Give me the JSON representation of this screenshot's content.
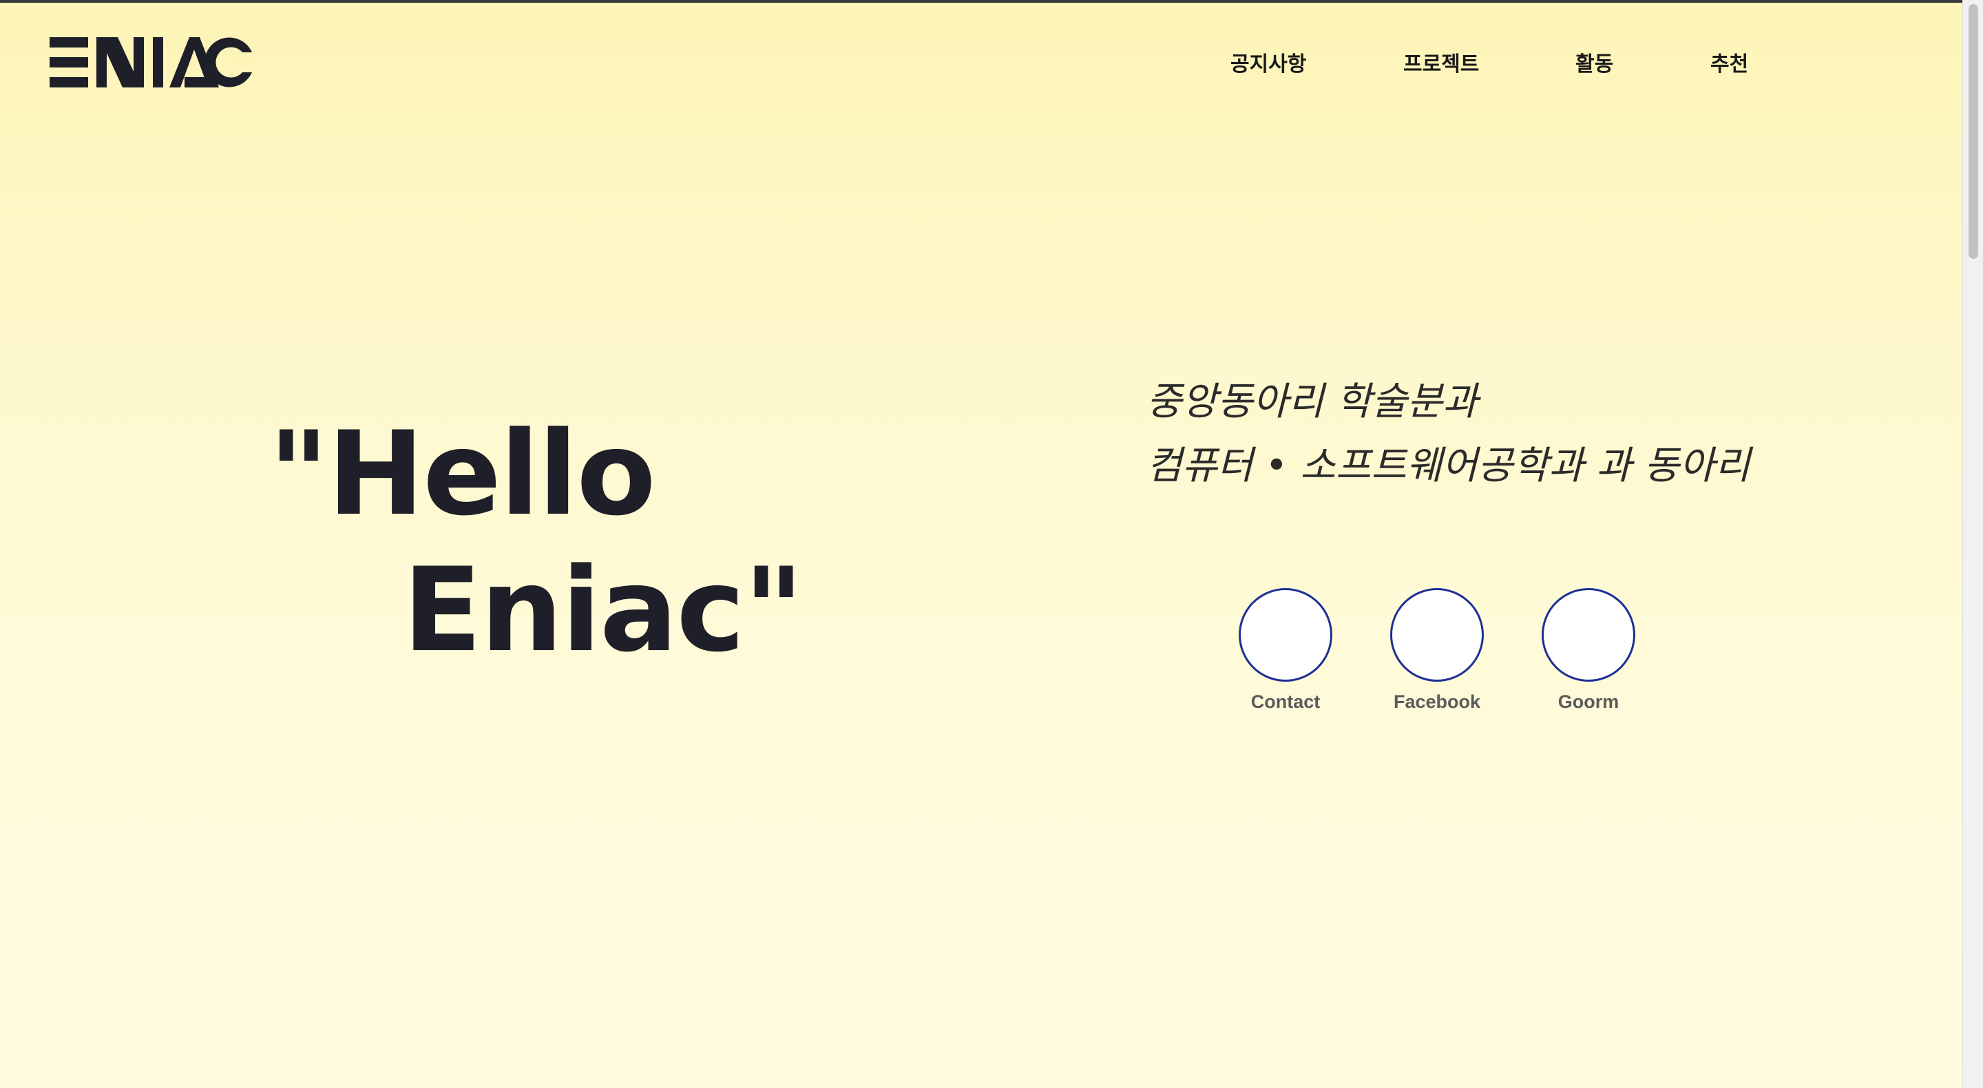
{
  "brand": {
    "logo_text": "ENIAC",
    "logo_color": "#1f1f29"
  },
  "nav": {
    "items": [
      {
        "label": "공지사항"
      },
      {
        "label": "프로젝트"
      },
      {
        "label": "활동"
      },
      {
        "label": "추천"
      }
    ]
  },
  "hero": {
    "line1": "\"Hello",
    "line2": "Eniac\""
  },
  "tagline": {
    "line1": "중앙동아리 학술분과",
    "line2": "컴퓨터 • 소프트웨어공학과 과 동아리"
  },
  "social": {
    "links": [
      {
        "label": "Contact"
      },
      {
        "label": "Facebook"
      },
      {
        "label": "Goorm"
      }
    ],
    "circle_border_color": "#1e2f96"
  },
  "theme": {
    "background_top": "#fdf4b6",
    "background_bottom": "#fffbdf",
    "text_color": "#1f1f29"
  }
}
